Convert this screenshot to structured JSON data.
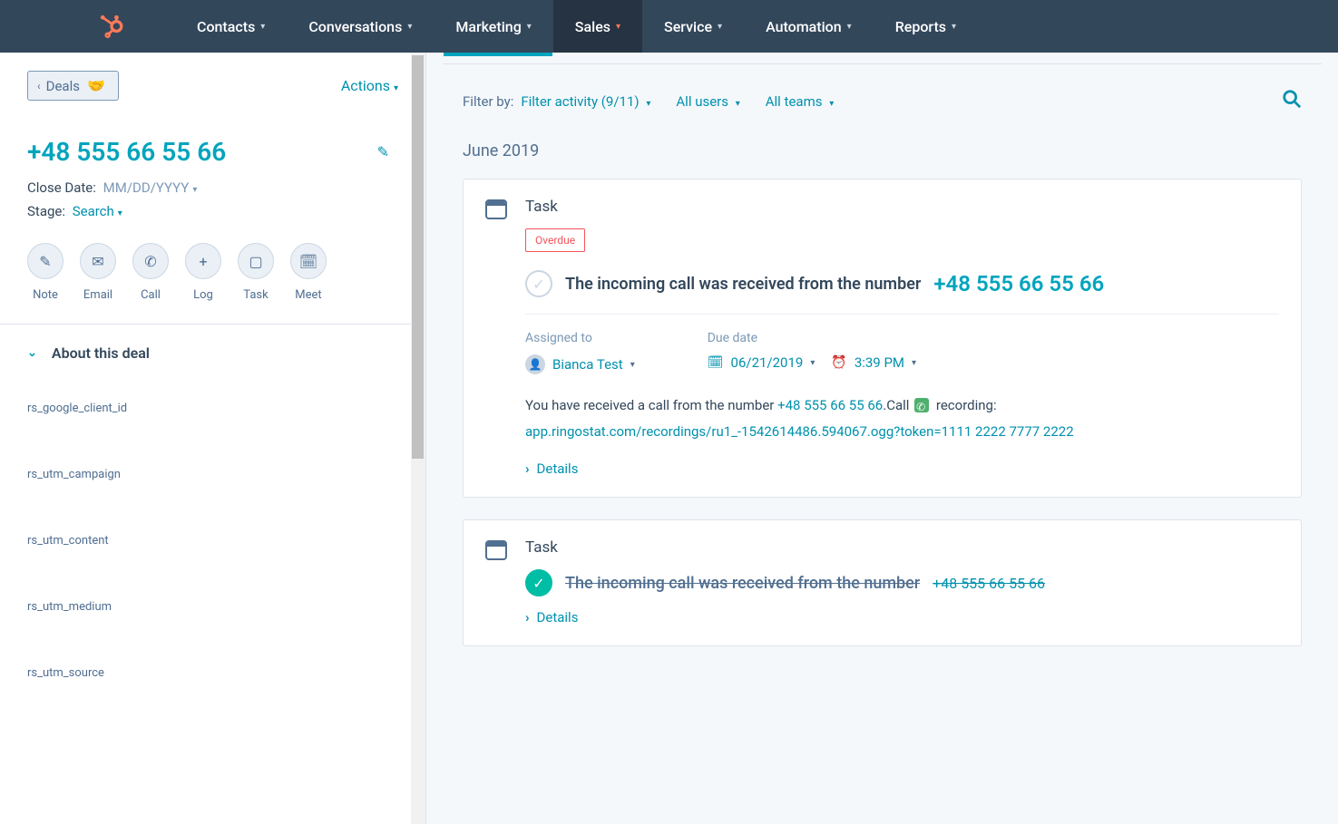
{
  "nav": {
    "items": [
      {
        "label": "Contacts"
      },
      {
        "label": "Conversations"
      },
      {
        "label": "Marketing"
      },
      {
        "label": "Sales",
        "active": true
      },
      {
        "label": "Service"
      },
      {
        "label": "Automation"
      },
      {
        "label": "Reports"
      }
    ]
  },
  "sidebar": {
    "back_label": "Deals",
    "actions_label": "Actions",
    "title": "+48 555 66 55 66",
    "close_date_label": "Close Date:",
    "close_date_value": "MM/DD/YYYY",
    "stage_label": "Stage:",
    "stage_value": "Search",
    "action_buttons": [
      {
        "label": "Note"
      },
      {
        "label": "Email"
      },
      {
        "label": "Call"
      },
      {
        "label": "Log"
      },
      {
        "label": "Task"
      },
      {
        "label": "Meet"
      }
    ],
    "about_section": "About this deal",
    "properties": [
      {
        "label": "rs_google_client_id"
      },
      {
        "label": "rs_utm_campaign"
      },
      {
        "label": "rs_utm_content"
      },
      {
        "label": "rs_utm_medium"
      },
      {
        "label": "rs_utm_source"
      }
    ]
  },
  "main": {
    "filter_label": "Filter by:",
    "filter_activity": "Filter activity (9/11)",
    "filter_users": "All users",
    "filter_teams": "All teams",
    "month": "June 2019",
    "task1": {
      "type": "Task",
      "overdue": "Overdue",
      "title": "The incoming call was received from the number",
      "number": "+48 555 66 55 66",
      "assigned_label": "Assigned to",
      "assigned_to": "Bianca Test",
      "due_label": "Due date",
      "due_date": "06/21/2019",
      "due_time": "3:39 PM",
      "desc_prefix": "You have received a call from the number ",
      "desc_number": "+48 555 66 55 66",
      "desc_call": ".Call",
      "desc_rec": " recording: ",
      "desc_url": "app.ringostat.com/recordings/ru1_-1542614486.594067.ogg?token=1111 2222 7777 2222",
      "details": "Details"
    },
    "task2": {
      "type": "Task",
      "title": "The incoming call was received from the number",
      "number": "+48 555 66 55 66",
      "details": "Details"
    }
  }
}
